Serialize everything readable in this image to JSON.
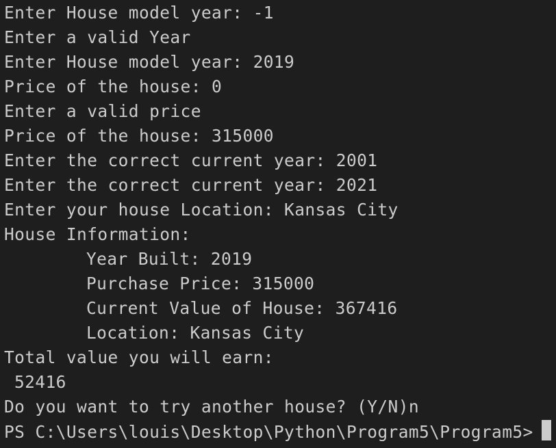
{
  "terminal": {
    "lines": [
      "Enter House model year: -1",
      "Enter a valid Year",
      "Enter House model year: 2019",
      "Price of the house: 0",
      "Enter a valid price",
      "Price of the house: 315000",
      "Enter the correct current year: 2001",
      "Enter the correct current year: 2021",
      "Enter your house Location: Kansas City",
      "House Information:",
      "Year Built: 2019",
      "Purchase Price: 315000",
      "Current Value of House: 367416",
      "Location: Kansas City",
      "Total value you will earn:",
      "52416",
      "Do you want to try another house? (Y/N)n"
    ],
    "prompt": "PS C:\\Users\\louis\\Desktop\\Python\\Program5\\Program5>"
  },
  "colors": {
    "background": "#1e1e1e",
    "text": "#cccccc"
  }
}
